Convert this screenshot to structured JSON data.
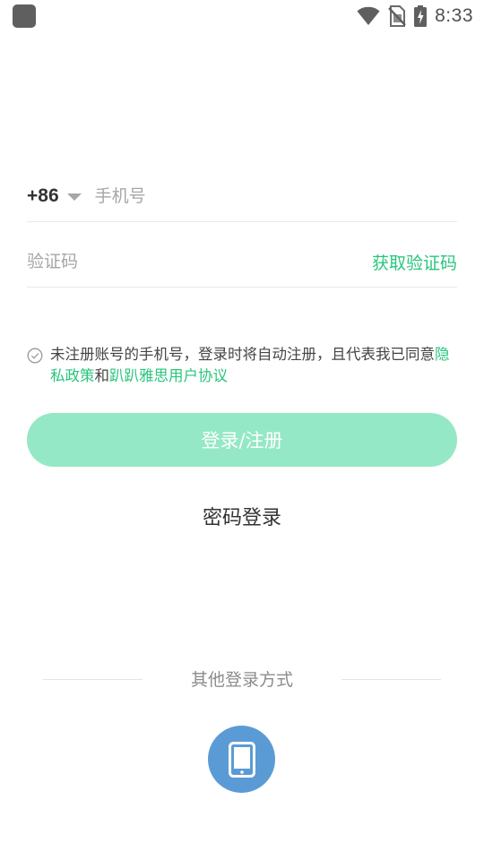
{
  "status_bar": {
    "time": "8:33",
    "icons": [
      "app-icon",
      "wifi-icon",
      "no-sim-icon",
      "battery-charging-icon"
    ]
  },
  "phone": {
    "country_code": "+86",
    "placeholder": "手机号",
    "value": ""
  },
  "code": {
    "placeholder": "验证码",
    "value": "",
    "get_code_label": "获取验证码"
  },
  "agreement": {
    "prefix": "未注册账号的手机号，登录时将自动注册，且代表我已同意",
    "privacy_link": "隐私政策",
    "conjunction": "和",
    "terms_link": "趴趴雅思用户协议",
    "checked": false
  },
  "login_button": {
    "label": "登录/注册"
  },
  "password_login": {
    "label": "密码登录"
  },
  "other_methods": {
    "label": "其他登录方式",
    "methods": [
      {
        "icon": "tablet-icon"
      }
    ]
  },
  "colors": {
    "accent": "#28c57c",
    "login_button_disabled": "#95e8c5",
    "phone_method": "#5b9bd5"
  }
}
